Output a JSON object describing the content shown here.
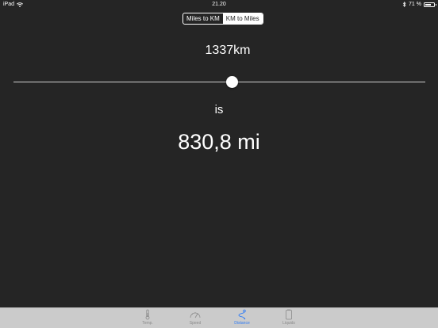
{
  "status_bar": {
    "device": "iPad",
    "time": "21.20",
    "battery_percent": "71 %",
    "battery_level": 0.71
  },
  "segmented": {
    "options": [
      "Miles to KM",
      "KM to Miles"
    ],
    "selected_index": 1
  },
  "converter": {
    "input_value": "1337km",
    "slider_fraction": 0.53,
    "connector": "is",
    "result": "830,8 mi"
  },
  "tab_bar": {
    "tabs": [
      {
        "label": "Temp.",
        "icon": "thermometer-icon"
      },
      {
        "label": "Speed",
        "icon": "speedometer-icon"
      },
      {
        "label": "Distance",
        "icon": "path-icon"
      },
      {
        "label": "Liquids",
        "icon": "container-icon"
      }
    ],
    "selected_index": 2
  },
  "colors": {
    "background": "#252525",
    "accent": "#2f7cf6",
    "tab_bar": "#cbcbcb"
  }
}
